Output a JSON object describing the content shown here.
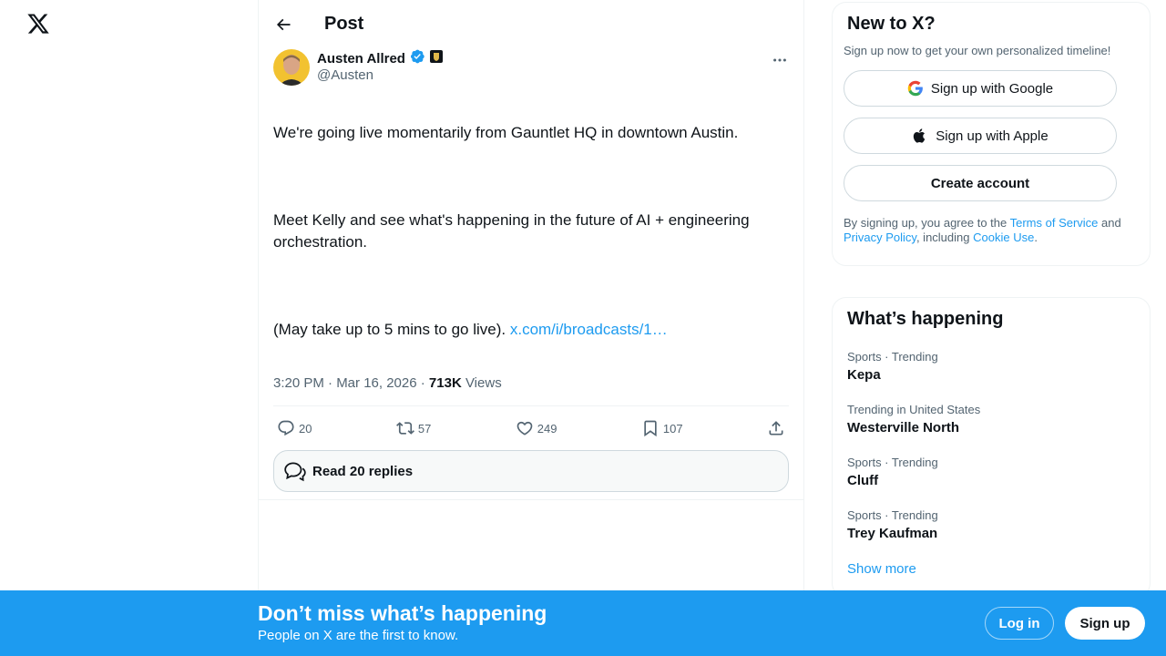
{
  "nav": {
    "logo_icon": "x-logo-icon"
  },
  "header": {
    "title": "Post"
  },
  "post": {
    "author_name": "Austen Allred",
    "handle": "@Austen",
    "text_line1": "We're going live momentarily from Gauntlet HQ in downtown Austin.",
    "text_line2": "Meet Kelly and see what's happening in the future of AI + engineering orchestration.",
    "text_line3": "(May take up to 5 mins to go live). ",
    "link": "x.com/i/broadcasts/1…",
    "timestamp": "3:20 PM · Mar 16, 2026 · ",
    "views_count": "713K",
    "views_label": " Views",
    "replies": "20",
    "reposts": "57",
    "likes": "249",
    "bookmarks": "107",
    "read_replies": "Read 20 replies"
  },
  "signup": {
    "title": "New to X?",
    "subtitle": "Sign up now to get your own personalized timeline!",
    "google": "Sign up with Google",
    "apple": "Sign up with Apple",
    "create": "Create account",
    "terms_prefix": "By signing up, you agree to the ",
    "terms_link": "Terms of Service",
    "terms_and": " and ",
    "privacy_link": "Privacy Policy",
    "including": ", including ",
    "cookie_link": "Cookie Use",
    "period": "."
  },
  "trends": {
    "title": "What’s happening",
    "items": [
      {
        "meta": "Sports · Trending",
        "name": "Kepa"
      },
      {
        "meta": "Trending in United States",
        "name": "Westerville North"
      },
      {
        "meta": "Sports · Trending",
        "name": "Cluff"
      },
      {
        "meta": "Sports · Trending",
        "name": "Trey Kaufman"
      }
    ],
    "show_more": "Show more"
  },
  "banner": {
    "title": "Don’t miss what’s happening",
    "subtitle": "People on X are the first to know.",
    "login": "Log in",
    "signup": "Sign up"
  },
  "colors": {
    "accent": "#1d9bf0",
    "text": "#0f1419",
    "muted": "#536471"
  }
}
